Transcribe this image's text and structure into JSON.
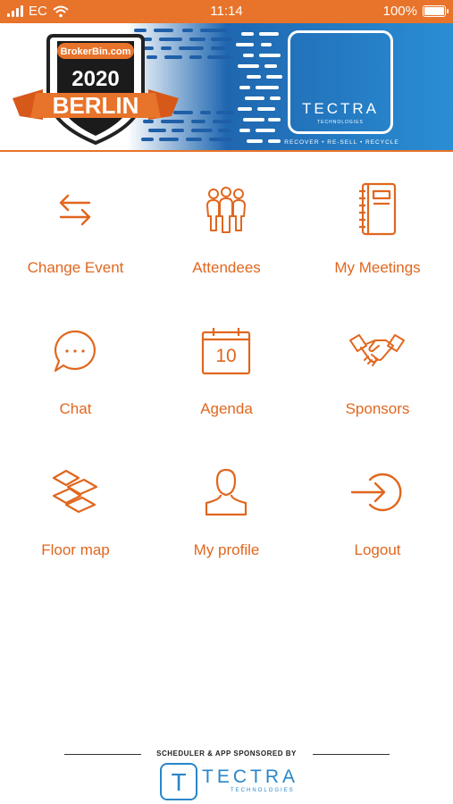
{
  "status_bar": {
    "carrier": "EC",
    "time": "11:14",
    "battery": "100%"
  },
  "banner": {
    "badge_site": "BrokerBin.com",
    "badge_year": "2020",
    "badge_city": "BERLIN",
    "sponsor_name": "TECTRA",
    "sponsor_sub": "TECHNOLOGIES",
    "sponsor_tagline": "RECOVER • RE-SELL • RECYCLE"
  },
  "menu": {
    "change_event": "Change Event",
    "attendees": "Attendees",
    "my_meetings": "My Meetings",
    "chat": "Chat",
    "agenda": "Agenda",
    "agenda_day": "10",
    "sponsors": "Sponsors",
    "floor_map": "Floor map",
    "my_profile": "My profile",
    "logout": "Logout"
  },
  "footer": {
    "caption": "SCHEDULER & APP SPONSORED BY",
    "logo_letter": "T",
    "name": "TECTRA",
    "sub": "TECHNOLOGIES"
  },
  "colors": {
    "accent": "#e8732a",
    "menu_text": "#e0671f",
    "banner_blue": "#1f67b0",
    "footer_blue": "#2a86c9"
  }
}
